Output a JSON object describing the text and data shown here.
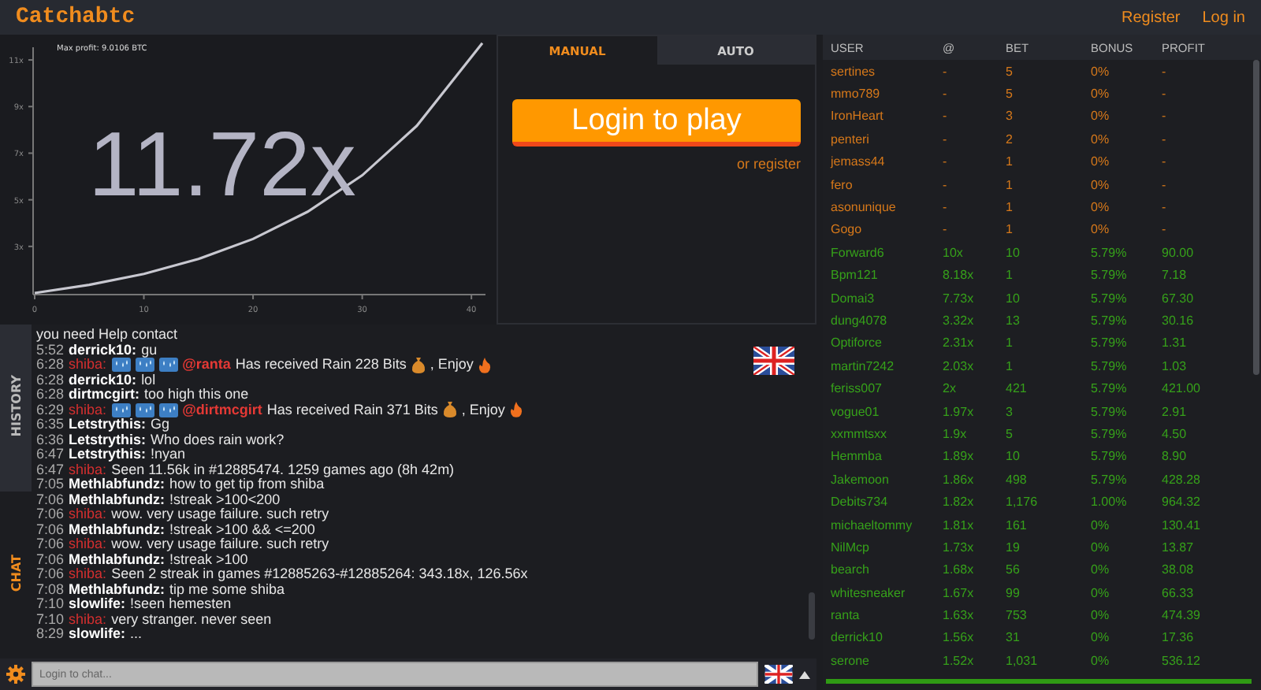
{
  "header": {
    "logo": "Catchabtc",
    "links": [
      "Register",
      "Log in"
    ]
  },
  "graph": {
    "max_profit": "Max profit: 9.0106 BTC",
    "multiplier": "11.72x",
    "chart_data": {
      "type": "line",
      "x": [
        0,
        5,
        10,
        15,
        20,
        25,
        30,
        35,
        41
      ],
      "series": [
        {
          "color": "#c8c8d0",
          "values": [
            1,
            1.35,
            1.82,
            2.46,
            3.32,
            4.49,
            6.05,
            8.17,
            11.72
          ]
        }
      ],
      "xlim": [
        0,
        41
      ],
      "ylim": [
        1,
        11.72
      ],
      "xticks": [
        0,
        10,
        20,
        30,
        40
      ],
      "yticks": [
        {
          "value": 3,
          "label": "3x"
        },
        {
          "value": 5,
          "label": "5x"
        },
        {
          "value": 7,
          "label": "7x"
        },
        {
          "value": 9,
          "label": "9x"
        },
        {
          "value": 11,
          "label": "11x"
        }
      ]
    }
  },
  "bet_panel": {
    "tabs": [
      {
        "label": "MANUAL",
        "selected": true
      },
      {
        "label": "AUTO",
        "selected": false
      }
    ],
    "login_button": "Login to play",
    "register_link": "or register"
  },
  "players": {
    "columns": [
      "USER",
      "@",
      "BET",
      "BONUS",
      "PROFIT"
    ],
    "rows": [
      {
        "user": "sertines",
        "at": "-",
        "bet": "5",
        "bonus": "0%",
        "profit": "-",
        "cashed_out": false
      },
      {
        "user": "mmo789",
        "at": "-",
        "bet": "5",
        "bonus": "0%",
        "profit": "-",
        "cashed_out": false
      },
      {
        "user": "IronHeart",
        "at": "-",
        "bet": "3",
        "bonus": "0%",
        "profit": "-",
        "cashed_out": false
      },
      {
        "user": "penteri",
        "at": "-",
        "bet": "2",
        "bonus": "0%",
        "profit": "-",
        "cashed_out": false
      },
      {
        "user": "jemass44",
        "at": "-",
        "bet": "1",
        "bonus": "0%",
        "profit": "-",
        "cashed_out": false
      },
      {
        "user": "fero",
        "at": "-",
        "bet": "1",
        "bonus": "0%",
        "profit": "-",
        "cashed_out": false
      },
      {
        "user": "asonunique",
        "at": "-",
        "bet": "1",
        "bonus": "0%",
        "profit": "-",
        "cashed_out": false
      },
      {
        "user": "Gogo",
        "at": "-",
        "bet": "1",
        "bonus": "0%",
        "profit": "-",
        "cashed_out": false
      },
      {
        "user": "Forward6",
        "at": "10x",
        "bet": "10",
        "bonus": "5.79%",
        "profit": "90.00",
        "cashed_out": true
      },
      {
        "user": "Bpm121",
        "at": "8.18x",
        "bet": "1",
        "bonus": "5.79%",
        "profit": "7.18",
        "cashed_out": true
      },
      {
        "user": "Domai3",
        "at": "7.73x",
        "bet": "10",
        "bonus": "5.79%",
        "profit": "67.30",
        "cashed_out": true
      },
      {
        "user": "dung4078",
        "at": "3.32x",
        "bet": "13",
        "bonus": "5.79%",
        "profit": "30.16",
        "cashed_out": true
      },
      {
        "user": "Optiforce",
        "at": "2.31x",
        "bet": "1",
        "bonus": "5.79%",
        "profit": "1.31",
        "cashed_out": true
      },
      {
        "user": "martin7242",
        "at": "2.03x",
        "bet": "1",
        "bonus": "5.79%",
        "profit": "1.03",
        "cashed_out": true
      },
      {
        "user": "feriss007",
        "at": "2x",
        "bet": "421",
        "bonus": "5.79%",
        "profit": "421.00",
        "cashed_out": true
      },
      {
        "user": "vogue01",
        "at": "1.97x",
        "bet": "3",
        "bonus": "5.79%",
        "profit": "2.91",
        "cashed_out": true
      },
      {
        "user": "xxmmtsxx",
        "at": "1.9x",
        "bet": "5",
        "bonus": "5.79%",
        "profit": "4.50",
        "cashed_out": true
      },
      {
        "user": "Hemmba",
        "at": "1.89x",
        "bet": "10",
        "bonus": "5.79%",
        "profit": "8.90",
        "cashed_out": true
      },
      {
        "user": "Jakemoon",
        "at": "1.86x",
        "bet": "498",
        "bonus": "5.79%",
        "profit": "428.28",
        "cashed_out": true
      },
      {
        "user": "Debits734",
        "at": "1.82x",
        "bet": "1,176",
        "bonus": "1.00%",
        "profit": "964.32",
        "cashed_out": true
      },
      {
        "user": "michaeltommy",
        "at": "1.81x",
        "bet": "161",
        "bonus": "0%",
        "profit": "130.41",
        "cashed_out": true
      },
      {
        "user": "NilMcp",
        "at": "1.73x",
        "bet": "19",
        "bonus": "0%",
        "profit": "13.87",
        "cashed_out": true
      },
      {
        "user": "bearch",
        "at": "1.68x",
        "bet": "56",
        "bonus": "0%",
        "profit": "38.08",
        "cashed_out": true
      },
      {
        "user": "whitesneaker",
        "at": "1.67x",
        "bet": "99",
        "bonus": "0%",
        "profit": "66.33",
        "cashed_out": true
      },
      {
        "user": "ranta",
        "at": "1.63x",
        "bet": "753",
        "bonus": "0%",
        "profit": "474.39",
        "cashed_out": true
      },
      {
        "user": "derrick10",
        "at": "1.56x",
        "bet": "31",
        "bonus": "0%",
        "profit": "17.36",
        "cashed_out": true
      },
      {
        "user": "serone",
        "at": "1.52x",
        "bet": "1,031",
        "bonus": "0%",
        "profit": "536.12",
        "cashed_out": true
      }
    ]
  },
  "side_tabs": [
    {
      "label": "HISTORY",
      "selected": false
    },
    {
      "label": "CHAT",
      "selected": true
    }
  ],
  "chat": {
    "messages": [
      {
        "kind": "continuation",
        "text": "you need Help contact"
      },
      {
        "kind": "text",
        "time": "5:52",
        "user": "derrick10:",
        "bot": false,
        "text": "gu"
      },
      {
        "kind": "rain",
        "time": "6:28",
        "user": "shiba:",
        "bot": true,
        "mention": "@ranta",
        "text": "Has received Rain 228 Bits",
        "suffix": ", Enjoy"
      },
      {
        "kind": "text",
        "time": "6:28",
        "user": "derrick10:",
        "bot": false,
        "text": "lol"
      },
      {
        "kind": "text",
        "time": "6:28",
        "user": "dirtmcgirt:",
        "bot": false,
        "text": "too high this one"
      },
      {
        "kind": "rain",
        "time": "6:29",
        "user": "shiba:",
        "bot": true,
        "mention": "@dirtmcgirt",
        "text": "Has received Rain 371 Bits",
        "suffix": ", Enjoy"
      },
      {
        "kind": "text",
        "time": "6:35",
        "user": "Letstrythis:",
        "bot": false,
        "text": "Gg"
      },
      {
        "kind": "text",
        "time": "6:36",
        "user": "Letstrythis:",
        "bot": false,
        "text": "Who does rain work?"
      },
      {
        "kind": "text",
        "time": "6:47",
        "user": "Letstrythis:",
        "bot": false,
        "text": "!nyan"
      },
      {
        "kind": "text",
        "time": "6:47",
        "user": "shiba:",
        "bot": true,
        "text": "Seen 11.56k in #12885474. 1259 games ago (8h 42m)"
      },
      {
        "kind": "text",
        "time": "7:05",
        "user": "Methlabfundz:",
        "bot": false,
        "text": "how to get tip from shiba"
      },
      {
        "kind": "text",
        "time": "7:06",
        "user": "Methlabfundz:",
        "bot": false,
        "text": "!streak >100<200"
      },
      {
        "kind": "text",
        "time": "7:06",
        "user": "shiba:",
        "bot": true,
        "text": "wow. very usage failure. such retry"
      },
      {
        "kind": "text",
        "time": "7:06",
        "user": "Methlabfundz:",
        "bot": false,
        "text": "!streak >100 && <=200"
      },
      {
        "kind": "text",
        "time": "7:06",
        "user": "shiba:",
        "bot": true,
        "text": "wow. very usage failure. such retry"
      },
      {
        "kind": "text",
        "time": "7:06",
        "user": "Methlabfundz:",
        "bot": false,
        "text": "!streak >100"
      },
      {
        "kind": "text",
        "time": "7:06",
        "user": "shiba:",
        "bot": true,
        "text": "Seen 2 streak in games #12885263-#12885264: 343.18x, 126.56x"
      },
      {
        "kind": "text",
        "time": "7:08",
        "user": "Methlabfundz:",
        "bot": false,
        "text": "tip me some shiba"
      },
      {
        "kind": "text",
        "time": "7:10",
        "user": "slowlife:",
        "bot": false,
        "text": "!seen hemesten"
      },
      {
        "kind": "text",
        "time": "7:10",
        "user": "shiba:",
        "bot": true,
        "text": "very stranger. never seen"
      },
      {
        "kind": "text",
        "time": "8:29",
        "user": "slowlife:",
        "bot": false,
        "text": "..."
      }
    ],
    "input": {
      "placeholder": "Login to chat..."
    }
  }
}
